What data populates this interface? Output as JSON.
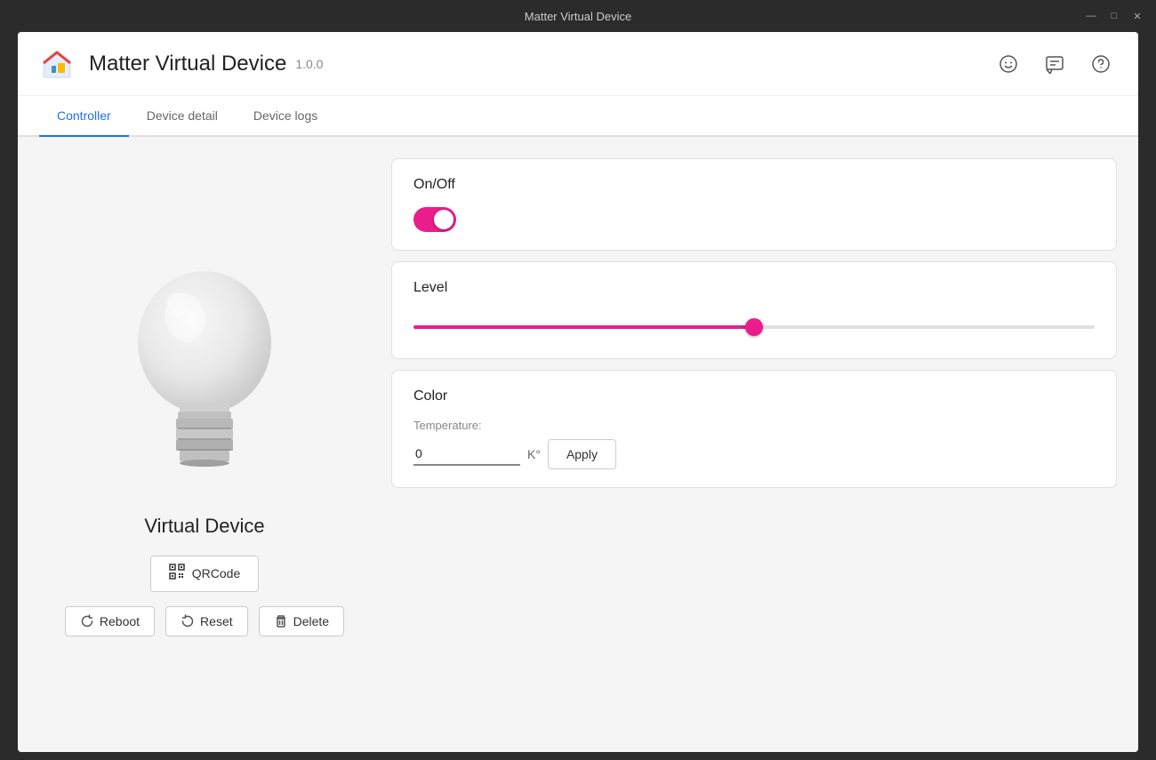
{
  "titleBar": {
    "title": "Matter Virtual Device",
    "controls": {
      "minimize": "—",
      "maximize": "□",
      "close": "✕"
    }
  },
  "header": {
    "appName": "Matter Virtual Device",
    "version": "1.0.0",
    "icons": {
      "smiley": "☺",
      "feedback": "⚠",
      "help": "?"
    }
  },
  "tabs": [
    {
      "id": "controller",
      "label": "Controller",
      "active": true
    },
    {
      "id": "device-detail",
      "label": "Device detail",
      "active": false
    },
    {
      "id": "device-logs",
      "label": "Device logs",
      "active": false
    }
  ],
  "leftPanel": {
    "deviceName": "Virtual Device",
    "qrcodeBtn": "QRCode",
    "buttons": {
      "reboot": "Reboot",
      "reset": "Reset",
      "delete": "Delete"
    }
  },
  "controls": {
    "onOff": {
      "label": "On/Off",
      "value": true
    },
    "level": {
      "label": "Level",
      "value": 50,
      "min": 0,
      "max": 100
    },
    "color": {
      "label": "Color",
      "temperatureLabel": "Temperature:",
      "temperatureValue": "0",
      "unit": "K°",
      "applyLabel": "Apply"
    }
  }
}
